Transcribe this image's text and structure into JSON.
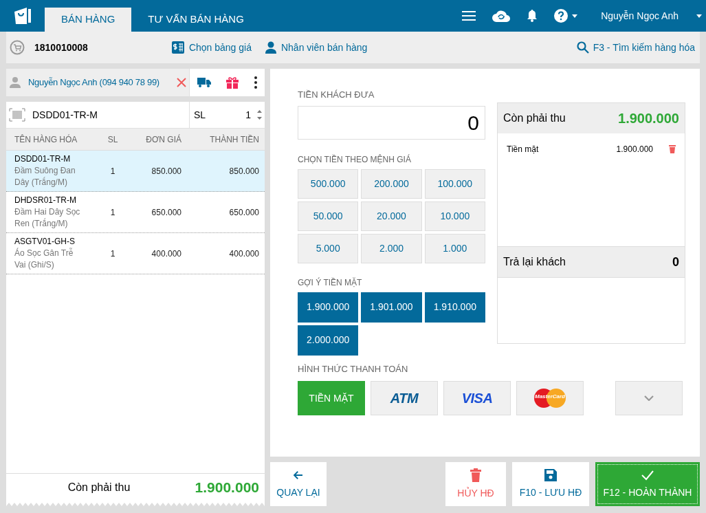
{
  "header": {
    "tabs": [
      {
        "label": "BÁN HÀNG",
        "selected": true
      },
      {
        "label": "TƯ VẤN BÁN HÀNG",
        "selected": false
      }
    ],
    "user": "Nguyễn Ngọc Anh"
  },
  "toolbar": {
    "invoice": "1810010008",
    "price_list": "Chọn bảng giá",
    "staff": "Nhân viên bán hàng",
    "search": "F3 - Tìm kiếm hàng hóa"
  },
  "customer": {
    "name": "Nguyễn Ngọc Anh (094 940 78 99)"
  },
  "scan": {
    "value": "DSDD01-TR-M",
    "qty_label": "SL",
    "qty": "1"
  },
  "table": {
    "columns": [
      "TÊN HÀNG HÓA",
      "SL",
      "ĐƠN GIÁ",
      "THÀNH TIỀN"
    ],
    "rows": [
      {
        "code": "DSDD01-TR-M",
        "name": "Đầm Suông Đan Dây (Trắng/M)",
        "qty": "1",
        "price": "850.000",
        "total": "850.000",
        "selected": true
      },
      {
        "code": "DHDSR01-TR-M",
        "name": "Đầm Hai Dây Sọc Ren (Trắng/M)",
        "qty": "1",
        "price": "650.000",
        "total": "650.000",
        "selected": false
      },
      {
        "code": "ASGTV01-GH-S",
        "name": "Áo Sọc Gân Trễ Vai (Ghi/S)",
        "qty": "1",
        "price": "400.000",
        "total": "400.000",
        "selected": false
      }
    ]
  },
  "left_total": {
    "label": "Còn phải thu",
    "value": "1.900.000"
  },
  "payment": {
    "given_label": "TIỀN KHÁCH ĐƯA",
    "given": "0",
    "denom_label": "CHỌN TIỀN THEO MỆNH GIÁ",
    "denominations": [
      "500.000",
      "200.000",
      "100.000",
      "50.000",
      "20.000",
      "10.000",
      "5.000",
      "2.000",
      "1.000"
    ],
    "suggest_label": "GỢI Ý TIỀN MẶT",
    "suggestions": [
      "1.900.000",
      "1.901.000",
      "1.910.000",
      "2.000.000"
    ],
    "method_label": "HÌNH THỨC THANH TOÁN",
    "methods": [
      {
        "kind": "text",
        "label": "TIỀN MẶT",
        "selected": true
      },
      {
        "kind": "atm",
        "label": "ATM",
        "selected": false
      },
      {
        "kind": "visa",
        "label": "VISA",
        "selected": false
      },
      {
        "kind": "mastercard",
        "label": "MasterCard",
        "selected": false
      }
    ]
  },
  "summary": {
    "due_label": "Còn phải thu",
    "due": "1.900.000",
    "lines": [
      {
        "label": "Tiền mặt",
        "value": "1.900.000"
      }
    ],
    "change_label": "Trả lại khách",
    "change": "0"
  },
  "actions": [
    {
      "kind": "back",
      "label": "QUAY LẠI"
    },
    {
      "kind": "cancel",
      "label": "HỦY HĐ"
    },
    {
      "kind": "save",
      "label": "F10 - LƯU HĐ"
    },
    {
      "kind": "complete",
      "label": "F12 - HOÀN THÀNH"
    }
  ]
}
